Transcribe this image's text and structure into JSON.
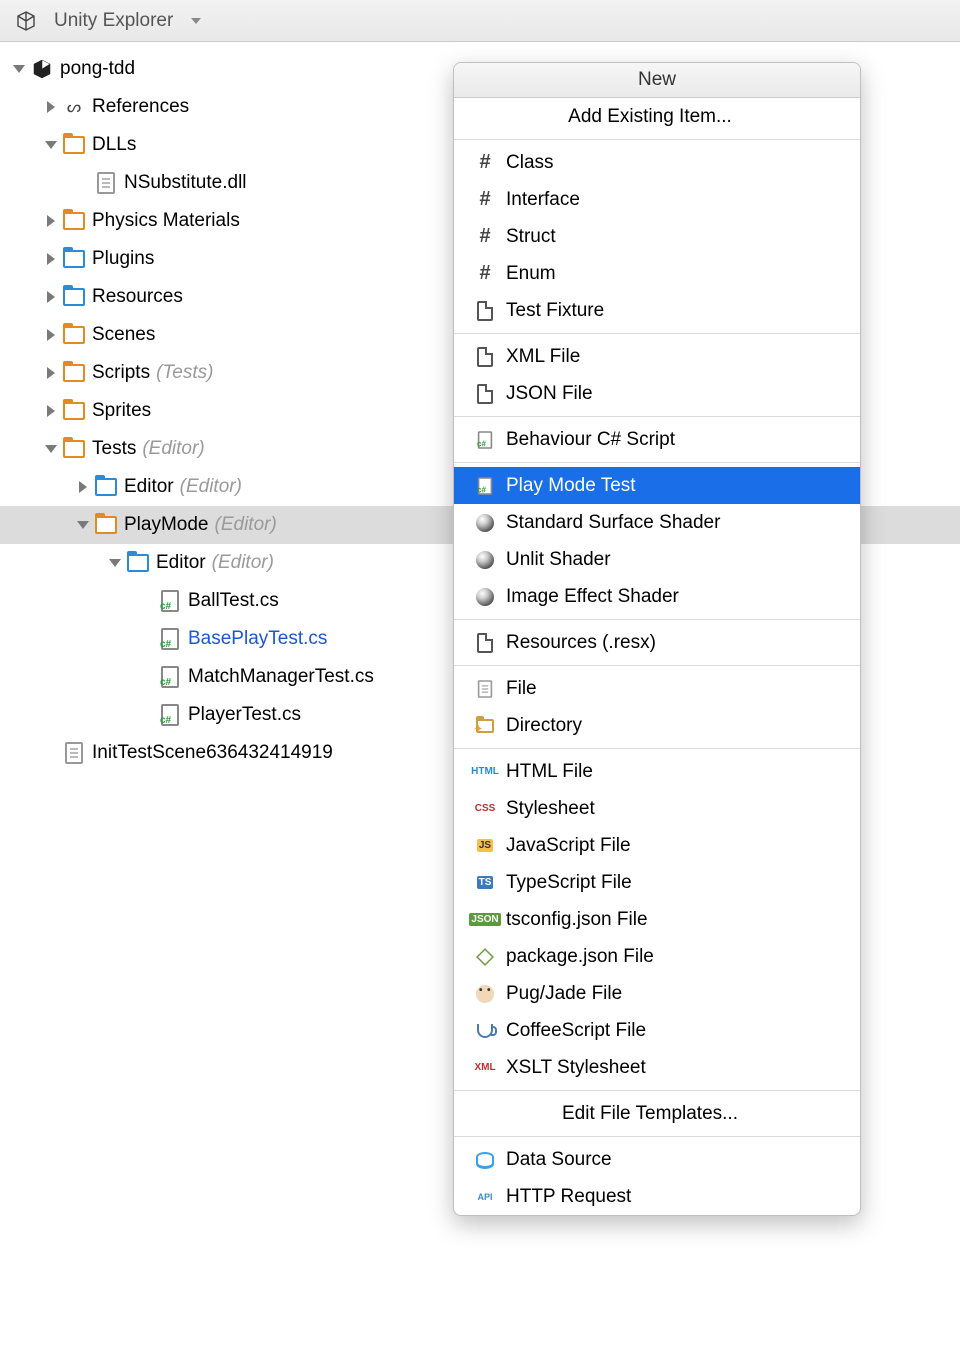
{
  "panel": {
    "title": "Unity Explorer"
  },
  "tree": {
    "root": {
      "name": "pong-tdd"
    },
    "references": "References",
    "dlls": {
      "name": "DLLs",
      "file": "NSubstitute.dll"
    },
    "physics": "Physics Materials",
    "plugins": "Plugins",
    "resources": "Resources",
    "scenes": "Scenes",
    "scripts": {
      "name": "Scripts",
      "ann": "(Tests)"
    },
    "sprites": "Sprites",
    "tests": {
      "name": "Tests",
      "ann": "(Editor)"
    },
    "tests_editor": {
      "name": "Editor",
      "ann": "(Editor)"
    },
    "playmode": {
      "name": "PlayMode",
      "ann": "(Editor)"
    },
    "playmode_editor": {
      "name": "Editor",
      "ann": "(Editor)"
    },
    "files": {
      "ball": "BallTest.cs",
      "base": "BasePlayTest.cs",
      "match": "MatchManagerTest.cs",
      "player": "PlayerTest.cs"
    },
    "inittest": "InitTestScene636432414919"
  },
  "menu": {
    "title": "New",
    "add_existing": "Add Existing Item...",
    "class": "Class",
    "interface": "Interface",
    "struct": "Struct",
    "enum": "Enum",
    "test_fixture": "Test Fixture",
    "xml": "XML File",
    "json": "JSON File",
    "behaviour": "Behaviour C# Script",
    "play_mode_test": "Play Mode Test",
    "std_shader": "Standard Surface Shader",
    "unlit_shader": "Unlit Shader",
    "image_shader": "Image Effect Shader",
    "resx": "Resources (.resx)",
    "file": "File",
    "directory": "Directory",
    "html": "HTML File",
    "stylesheet": "Stylesheet",
    "js": "JavaScript File",
    "ts": "TypeScript File",
    "tsconfig": "tsconfig.json File",
    "package": "package.json File",
    "pug": "Pug/Jade File",
    "coffee": "CoffeeScript File",
    "xslt": "XSLT Stylesheet",
    "edit_templates": "Edit File Templates...",
    "data_source": "Data Source",
    "http": "HTTP Request"
  }
}
